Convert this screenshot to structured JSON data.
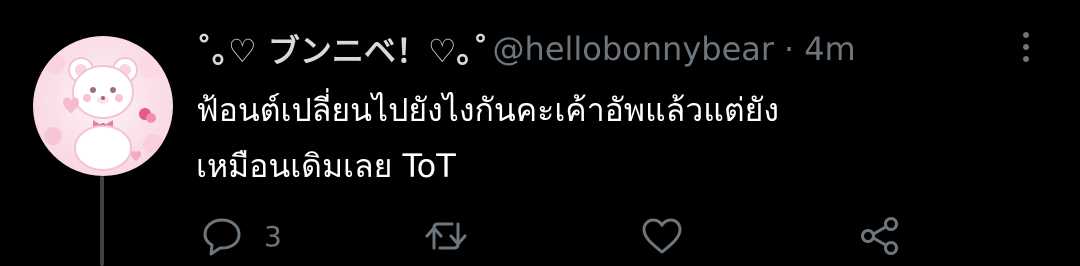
{
  "tweet": {
    "display_name": "˚｡♡ ブンニベ！♡｡˚",
    "handle": "@hellobonnybear",
    "separator": "·",
    "time": "4m",
    "text_lines": [
      "ฟ้อนต์เปลี่ยนไปยังไงกันคะเค้าอัพแล้วแต่ยัง",
      "เหมือนเดิมเลย ToT"
    ],
    "actions": {
      "reply_count": "3",
      "retweet_count": "",
      "like_count": ""
    }
  },
  "icons": {
    "reply": "reply-icon",
    "retweet": "retweet-icon",
    "like": "heart-icon",
    "share": "share-icon",
    "more": "more-vertical-icon"
  },
  "colors": {
    "background": "#000000",
    "text": "#ffffff",
    "secondary": "#6e767d",
    "avatar_pink": "#f6cfdc"
  }
}
